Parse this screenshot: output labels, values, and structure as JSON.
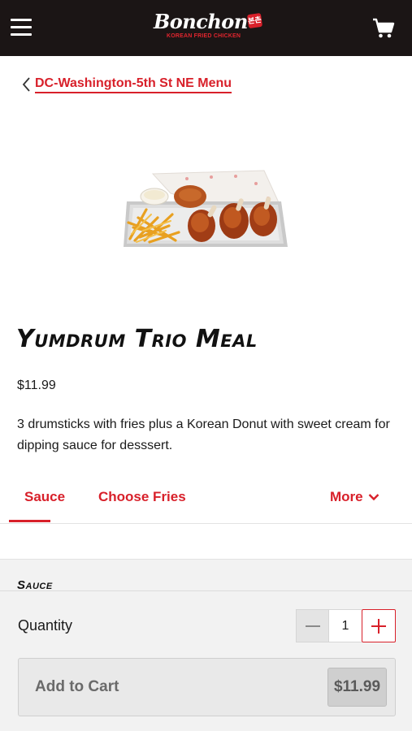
{
  "header": {
    "brand_name": "Bonchon",
    "brand_badge": "본촌",
    "brand_tagline": "KOREAN FRIED CHICKEN",
    "menu_icon": "hamburger-menu-icon",
    "cart_icon": "shopping-cart-icon"
  },
  "breadcrumb": {
    "back_icon": "chevron-left-icon",
    "label": "DC-Washington-5th St NE Menu"
  },
  "product": {
    "title": "Yumdrum Trio Meal",
    "price": "$11.99",
    "description": "3 drumsticks with fries plus a Korean Donut with sweet cream for dipping sauce for desssert.",
    "image_icon": "meal-tray-image"
  },
  "tabs": {
    "items": [
      {
        "label": "Sauce",
        "active": true
      },
      {
        "label": "Choose Fries",
        "active": false
      }
    ],
    "more_label": "More",
    "more_icon": "chevron-down-icon"
  },
  "options": {
    "section_heading": "Sauce"
  },
  "footer": {
    "quantity_label": "Quantity",
    "quantity_value": "1",
    "minus_icon": "minus-icon",
    "plus_icon": "plus-icon",
    "add_to_cart_label": "Add to Cart",
    "add_to_cart_price": "$11.99"
  },
  "colors": {
    "header_bg": "#1b1515",
    "accent_red": "#d8202a",
    "panel_bg": "#f2f2f2"
  }
}
